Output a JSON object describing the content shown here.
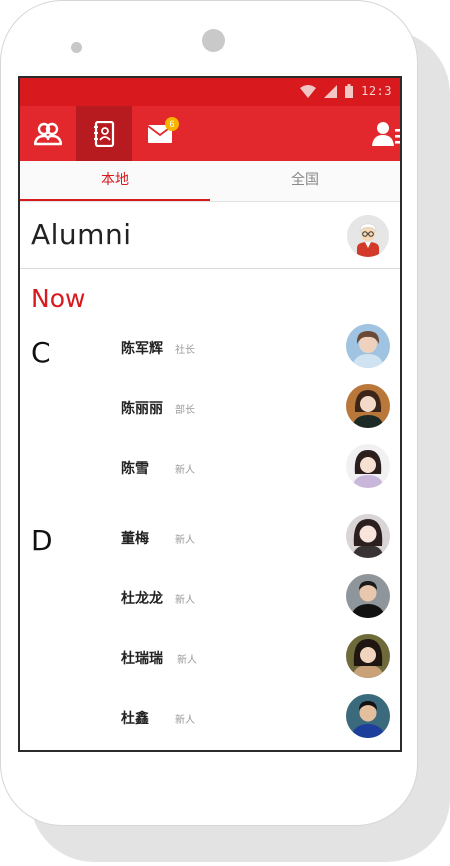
{
  "status_bar": {
    "time": "12:3"
  },
  "app_bar": {
    "tabs": [
      {
        "icon": "people-icon"
      },
      {
        "icon": "address-book-icon",
        "active": true
      },
      {
        "icon": "mail-icon",
        "badge": "6"
      }
    ],
    "right_icon": "user-list-icon"
  },
  "subtabs": [
    {
      "label": "本地",
      "active": true
    },
    {
      "label": "全国",
      "active": false
    }
  ],
  "header": {
    "title": "Alumni",
    "avatar": "professor-avatar"
  },
  "section": {
    "title": "Now"
  },
  "groups": [
    {
      "letter": "C",
      "people": [
        {
          "name": "陈军辉",
          "role": "社长"
        },
        {
          "name": "陈丽丽",
          "role": "部长"
        },
        {
          "name": "陈雪",
          "role": "新人"
        }
      ]
    },
    {
      "letter": "D",
      "people": [
        {
          "name": "董梅",
          "role": "新人"
        },
        {
          "name": "杜龙龙",
          "role": "新人"
        },
        {
          "name": "杜瑞瑞",
          "role": "新人"
        },
        {
          "name": "杜鑫",
          "role": "新人"
        }
      ]
    }
  ],
  "colors": {
    "accent": "#e2282d",
    "status": "#d8191e",
    "badge": "#f5b400"
  }
}
